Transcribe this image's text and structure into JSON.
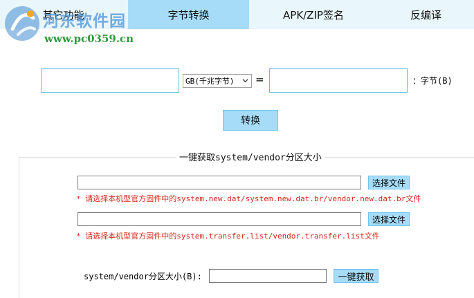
{
  "tabs": [
    {
      "label": "其它功能",
      "active": false
    },
    {
      "label": "字节转换",
      "active": true
    },
    {
      "label": "APK/ZIP签名",
      "active": false
    },
    {
      "label": "反编译",
      "active": false
    }
  ],
  "watermark": {
    "name": "河东软件园",
    "url": "www.pc0359.cn"
  },
  "converter": {
    "input_value": "",
    "unit_selected": "GB(千兆字节)",
    "equals": "=",
    "output_value": "",
    "output_unit": "：字节(B)",
    "convert_label": "转换"
  },
  "partition": {
    "legend": "一键获取system/vendor分区大小",
    "file1_value": "",
    "file1_button": "选择文件",
    "file1_hint": "* 请选择本机型官方固件中的system.new.dat/system.new.dat.br/vendor.new.dat.br文件",
    "file2_value": "",
    "file2_button": "选择文件",
    "file2_hint": "* 请选择本机型官方固件中的system.transfer.list/vendor.transfer.list文件",
    "size_label": "system/vendor分区大小(B):",
    "size_value": "",
    "get_label": "一键获取"
  },
  "colors": {
    "accent": "#a6dcf7",
    "tabbar": "#e9f6fb",
    "hint": "#d4281c"
  }
}
